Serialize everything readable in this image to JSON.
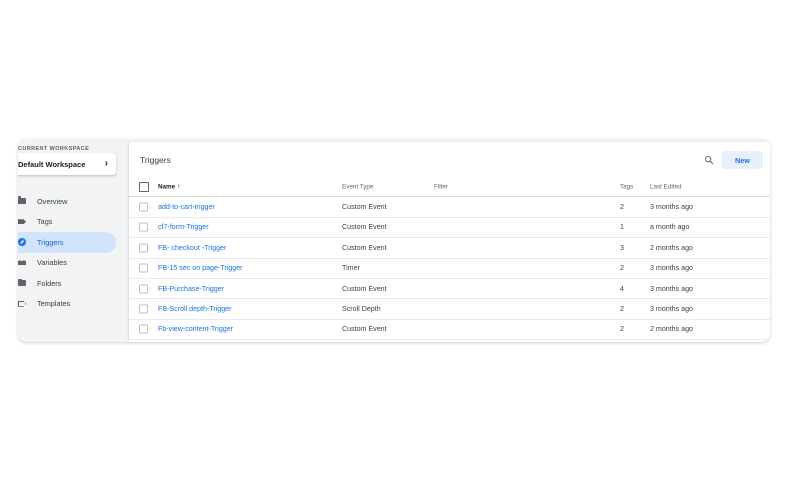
{
  "sidebar": {
    "workspace_label": "CURRENT WORKSPACE",
    "workspace_name": "Default Workspace",
    "items": [
      {
        "label": "Overview",
        "icon": "overview-icon"
      },
      {
        "label": "Tags",
        "icon": "tag-icon"
      },
      {
        "label": "Triggers",
        "icon": "trigger-icon",
        "active": true
      },
      {
        "label": "Variables",
        "icon": "variables-icon"
      },
      {
        "label": "Folders",
        "icon": "folder-icon"
      },
      {
        "label": "Templates",
        "icon": "template-icon"
      }
    ]
  },
  "main": {
    "title": "Triggers",
    "new_label": "New",
    "columns": {
      "name": "Name",
      "sort": "↑",
      "type": "Event Type",
      "filter": "Filter",
      "tags": "Tags",
      "edited": "Last Edited"
    },
    "rows": [
      {
        "name": "add-to-cart-trigger",
        "type": "Custom Event",
        "filter": "",
        "tags": "2",
        "edited": "3 months ago"
      },
      {
        "name": "cf7-form-Trigger",
        "type": "Custom Event",
        "filter": "",
        "tags": "1",
        "edited": "a month ago"
      },
      {
        "name": "FB- checkout -Trigger",
        "type": "Custom Event",
        "filter": "",
        "tags": "3",
        "edited": "2 months ago"
      },
      {
        "name": "FB-15 sec on page-Trigger",
        "type": "Timer",
        "filter": "",
        "tags": "2",
        "edited": "3 months ago"
      },
      {
        "name": "FB-Purchase-Trigger",
        "type": "Custom Event",
        "filter": "",
        "tags": "4",
        "edited": "3 months ago"
      },
      {
        "name": "FB-Scroll depth-Trigger",
        "type": "Scroll Depth",
        "filter": "",
        "tags": "2",
        "edited": "3 months ago"
      },
      {
        "name": "Fb-view-content-Trigger",
        "type": "Custom Event",
        "filter": "",
        "tags": "2",
        "edited": "2 months ago"
      }
    ]
  },
  "colors": {
    "accent": "#1a73e8",
    "active_bg": "#d2e3fc",
    "new_button_bg": "#e8f0fe",
    "frame_bg": "#f1f3f4"
  }
}
